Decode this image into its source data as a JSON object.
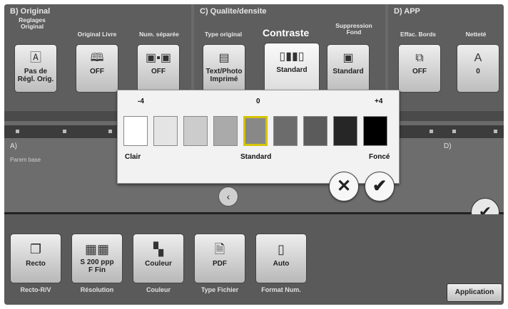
{
  "toolbar": {
    "section_b": {
      "title": "B) Original",
      "head1": "Reglages\nOriginal",
      "head2": "Original Livre",
      "head3": "Num. séparée",
      "btn1": "Pas de\nRégl. Orig.",
      "btn2": "OFF",
      "btn3": "OFF"
    },
    "section_c": {
      "title": "C) Qualite/densite",
      "head1": "Type original",
      "head2": "Contraste",
      "head3": "Suppression\nFond",
      "btn1": "Text/Photo\nImprimé",
      "btn2": "Standard",
      "btn3": "Standard"
    },
    "section_d": {
      "title": "D) APP",
      "head1": "Effac. Bords",
      "head2": "Netteté",
      "btn1": "OFF",
      "btn2": "0"
    }
  },
  "slider_labels": {
    "a": "A)",
    "a_sub": "Parem base",
    "d": "D)"
  },
  "contrast_popup": {
    "tick_min": "-4",
    "tick_mid": "0",
    "tick_max": "+4",
    "label_light": "Clair",
    "label_mid": "Standard",
    "label_dark": "Foncé",
    "selected_level": 0,
    "swatch_colors": [
      "#ffffff",
      "#e4e4e4",
      "#cccccc",
      "#aaaaaa",
      "#888888",
      "#6c6c6c",
      "#5b5b5b",
      "#262626",
      "#000000"
    ]
  },
  "bottom": {
    "btn1": "Recto",
    "cap1": "Recto-R/V",
    "btn2": "S 200 ppp\nF Fin",
    "cap2": "Résolution",
    "btn3": "Couleur",
    "cap3": "Couleur",
    "btn4": "PDF",
    "cap4": "Type Fichier",
    "btn5": "Auto",
    "cap5": "Format Num.",
    "application": "Application"
  }
}
